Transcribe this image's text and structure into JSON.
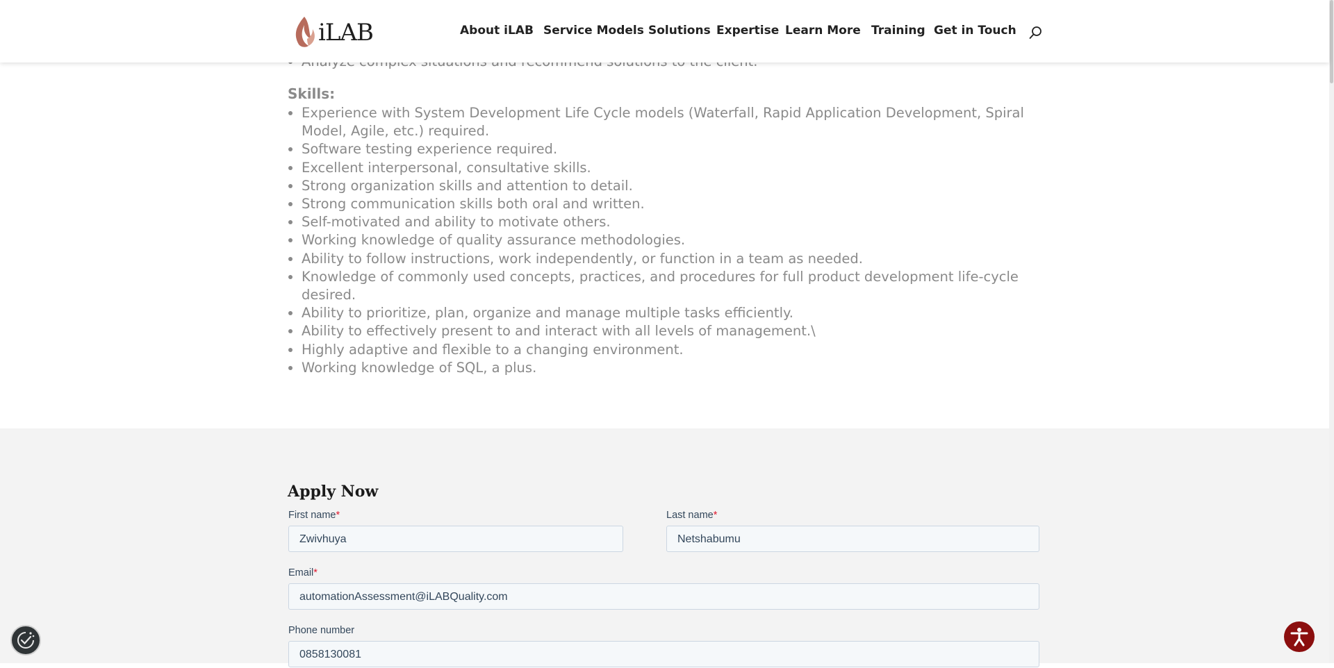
{
  "header": {
    "logo_text": "iLAB",
    "nav": [
      "About iLAB",
      "Service Models",
      "Solutions",
      "Expertise",
      "Learn More",
      "Training",
      "Get in Touch"
    ]
  },
  "content": {
    "cut_item": "Analyze complex situations and recommend solutions to the client.",
    "skills_heading": "Skills:",
    "skills": [
      "Experience with System Development Life Cycle models (Waterfall, Rapid Application Development, Spiral Model, Agile, etc.) required.",
      "Software testing experience required.",
      "Excellent interpersonal, consultative skills.",
      "Strong organization skills and attention to detail.",
      "Strong communication skills both oral and written.",
      "Self-motivated and ability to motivate others.",
      "Working knowledge of quality assurance methodologies.",
      "Ability to follow instructions, work independently, or function in a team as needed.",
      "Knowledge of commonly used concepts, practices, and procedures for full product development life-cycle desired.",
      "Ability to prioritize, plan, organize and manage multiple tasks efficiently.",
      "Ability to effectively present to and interact with all levels of management.\\",
      "Highly adaptive and flexible to a changing environment.",
      "Working knowledge of SQL, a plus."
    ]
  },
  "form": {
    "title": "Apply Now",
    "first_name_label": "First name",
    "first_name_value": "Zwivhuya",
    "last_name_label": "Last name",
    "last_name_value": "Netshabumu",
    "email_label": "Email",
    "email_value": "automationAssessment@iLABQuality.com",
    "phone_label": "Phone number",
    "phone_value": "0858130081",
    "required_mark": "*"
  },
  "colors": {
    "brand_red": "#8b0e0e",
    "text_gray": "#8a8a8a",
    "required_red": "#e0182d"
  }
}
